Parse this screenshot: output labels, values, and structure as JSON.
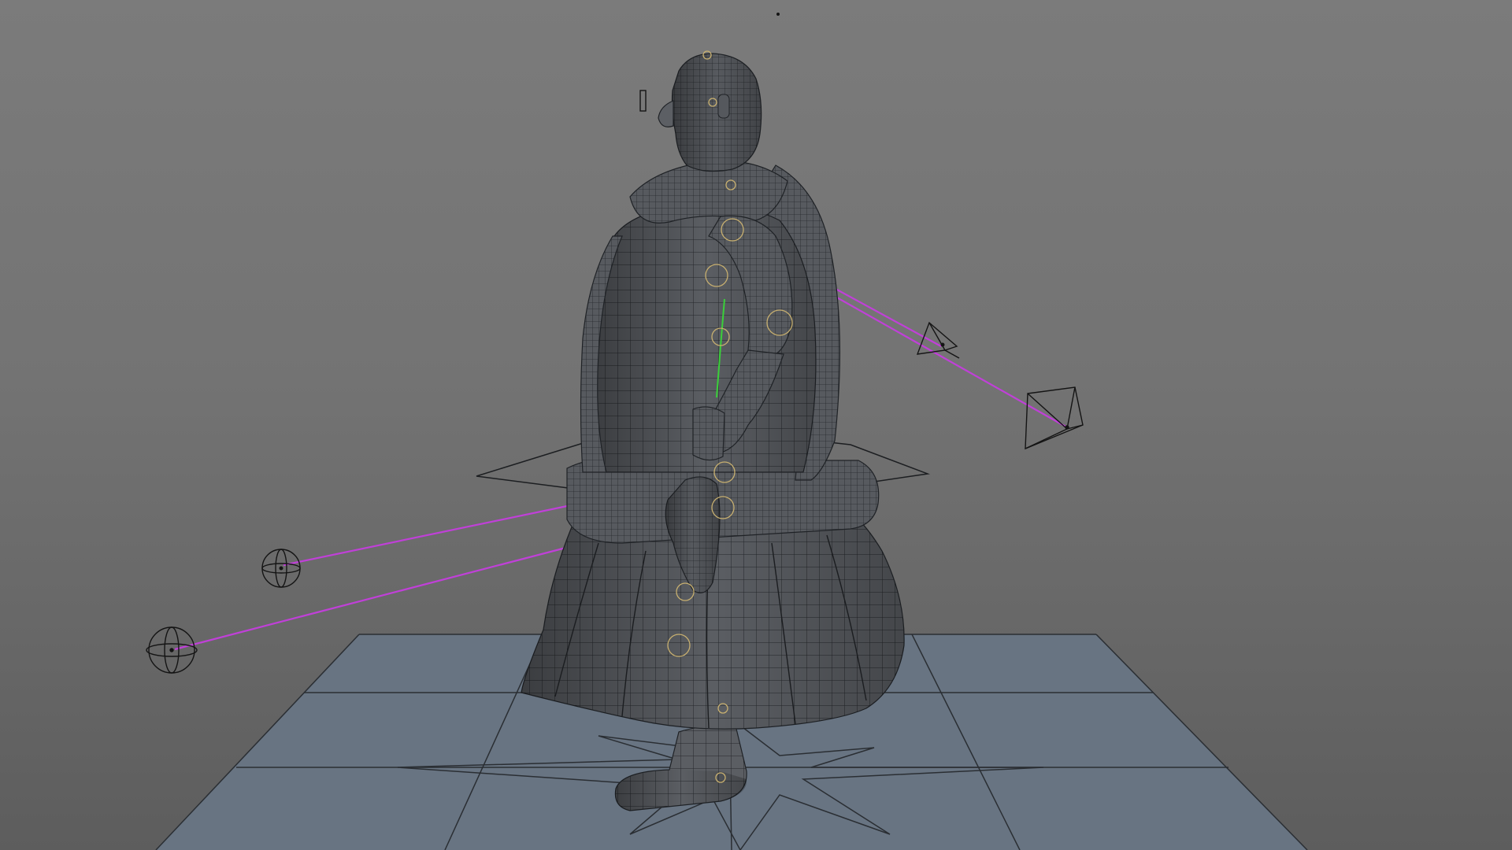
{
  "viewport": {
    "background_top_color": "#7b7b7b",
    "background_bottom_color": "#5d5d5d",
    "grid_floor_color": "#687482",
    "grid_line_color": "#2a2e33",
    "mesh_fill_color": "#5a5d62",
    "wireframe_color": "#1f2226",
    "ik_line_color": "#c040d8",
    "spine_bone_color": "#3ad03a",
    "joint_color": "#c8b070",
    "locator_color": "#141414"
  },
  "scene": {
    "subject": "character-model",
    "controls": [
      "floor-grid",
      "root-star-control",
      "hip-control",
      "elbow-pole-target",
      "elbow-pole-target",
      "knee-pole-sphere",
      "knee-pole-sphere",
      "eye-aim-locator"
    ]
  }
}
